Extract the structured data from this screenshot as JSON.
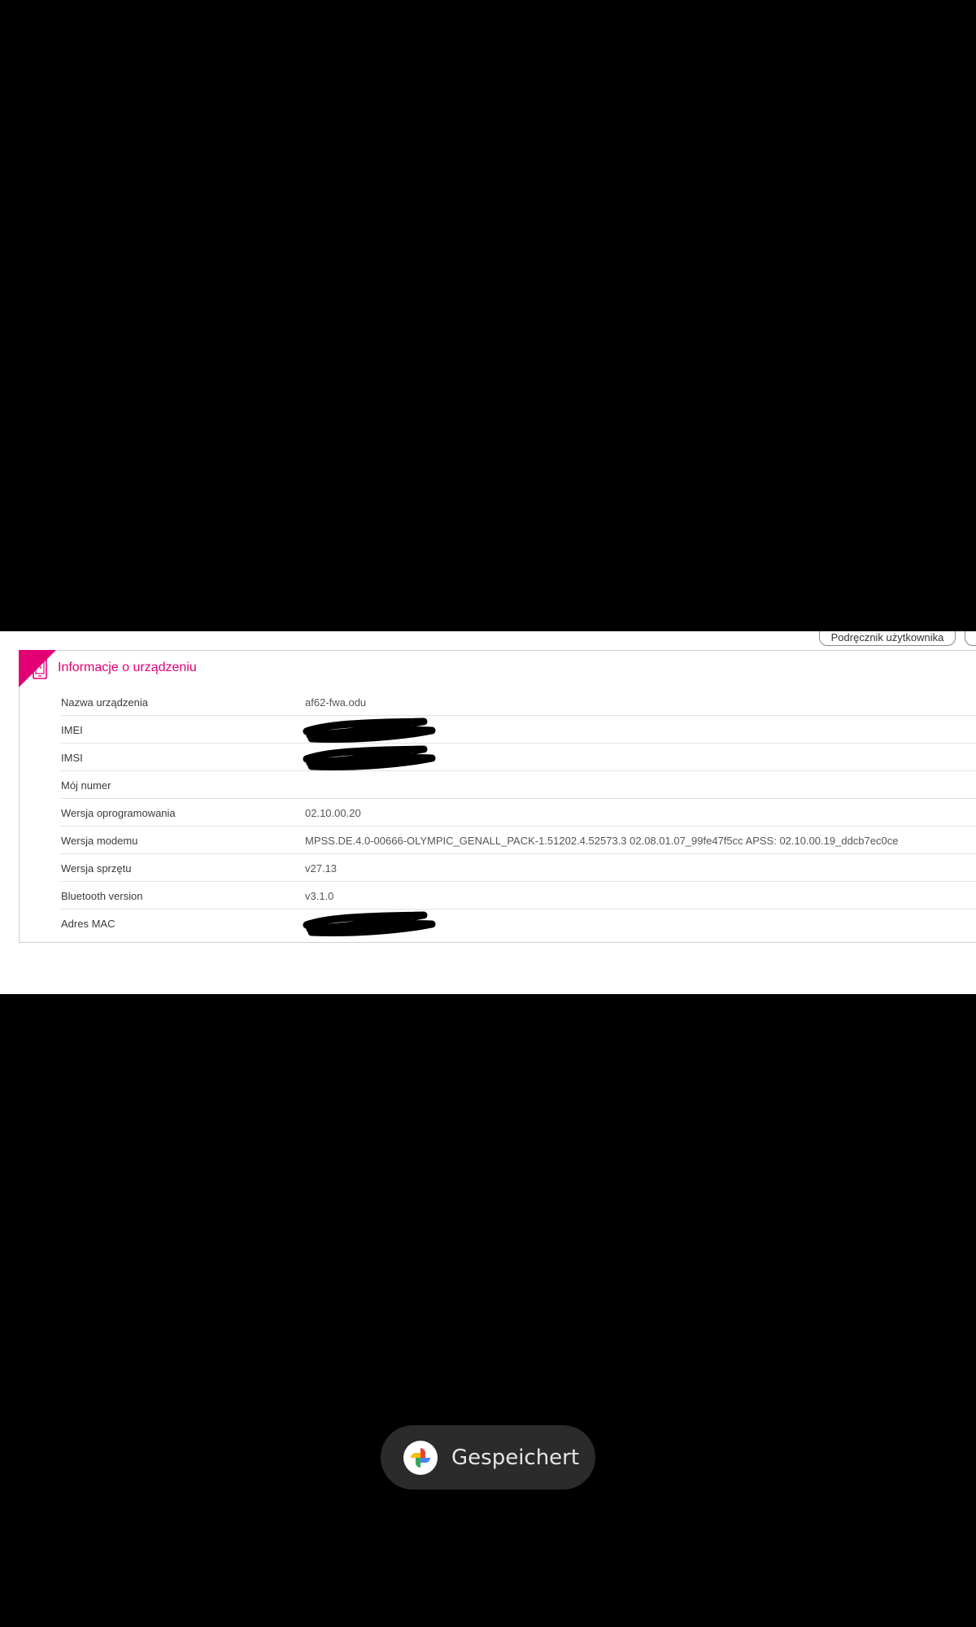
{
  "top_buttons": {
    "user_manual": "Podręcznik użytkownika"
  },
  "card": {
    "title": "Informacje o urządzeniu",
    "icon": "device-icon",
    "accent_color": "#e20074",
    "rows": [
      {
        "label": "Nazwa urządzenia",
        "value": "af62-fwa.odu",
        "redacted": false
      },
      {
        "label": "IMEI",
        "value": "",
        "redacted": true
      },
      {
        "label": "IMSI",
        "value": "",
        "redacted": true
      },
      {
        "label": "Mój numer",
        "value": "",
        "redacted": false
      },
      {
        "label": "Wersja oprogramowania",
        "value": "02.10.00.20",
        "redacted": false
      },
      {
        "label": "Wersja modemu",
        "value": "MPSS.DE.4.0-00666-OLYMPIC_GENALL_PACK-1.51202.4.52573.3 02.08.01.07_99fe47f5cc APSS: 02.10.00.19_ddcb7ec0ce",
        "redacted": false
      },
      {
        "label": "Wersja sprzętu",
        "value": "v27.13",
        "redacted": false
      },
      {
        "label": "Bluetooth version",
        "value": "v3.1.0",
        "redacted": false
      },
      {
        "label": "Adres MAC",
        "value": "",
        "redacted": true
      }
    ]
  },
  "toast": {
    "text": "Gespeichert",
    "icon": "google-photos-pinwheel-icon"
  }
}
